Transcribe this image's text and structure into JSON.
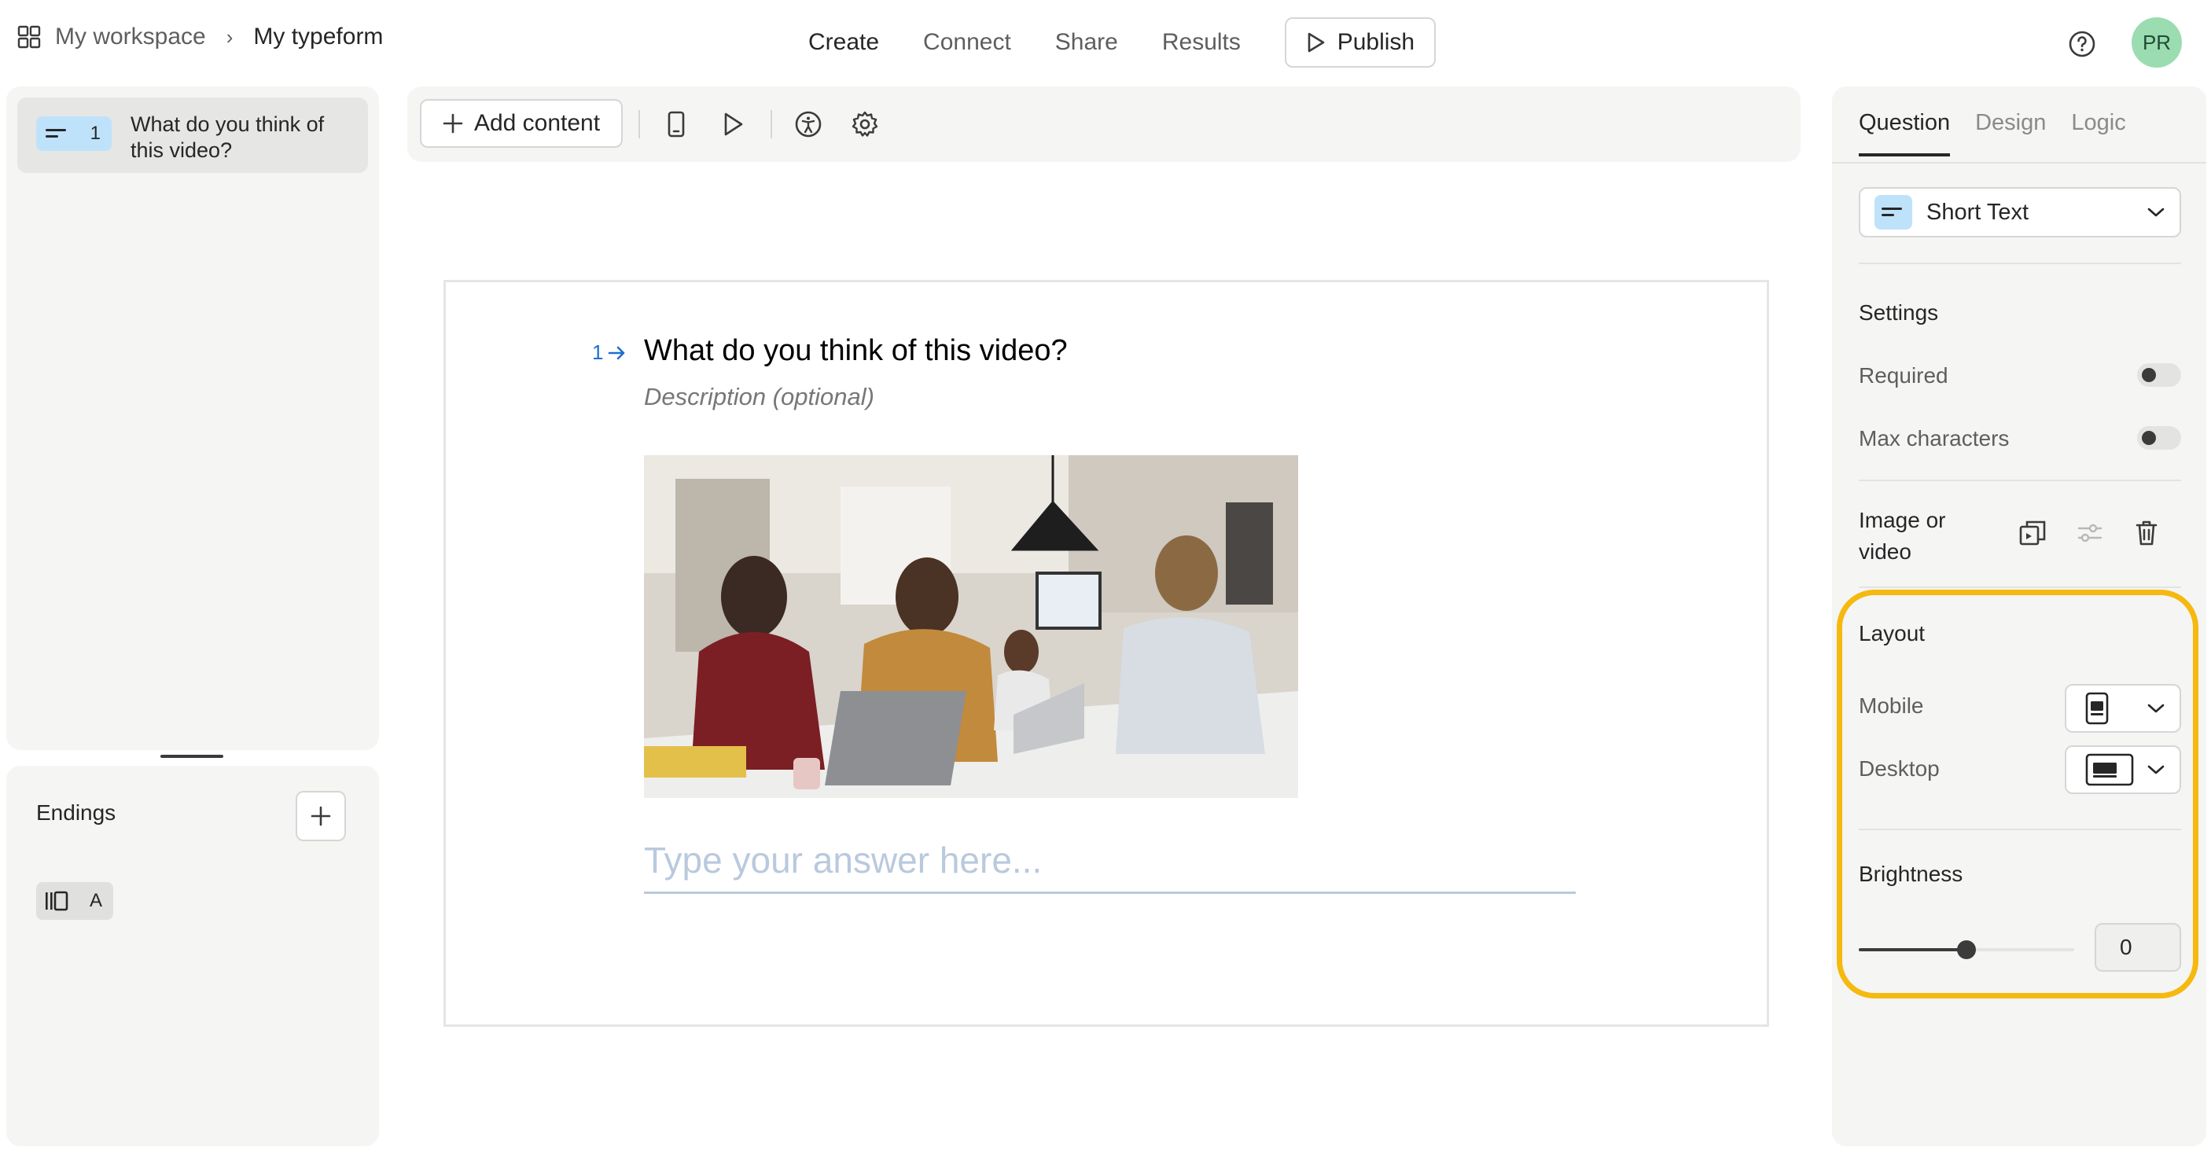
{
  "header": {
    "breadcrumb_workspace": "My workspace",
    "breadcrumb_separator": "›",
    "breadcrumb_form": "My typeform",
    "nav": [
      "Create",
      "Connect",
      "Share",
      "Results"
    ],
    "publish_label": "Publish",
    "avatar_initials": "PR"
  },
  "sidebar": {
    "question": {
      "type_icon": "short-text-icon",
      "number": "1",
      "label": "What do you think of this video?"
    },
    "endings_title": "Endings",
    "ending_badge": {
      "icon": "ending-icon",
      "label": "A"
    }
  },
  "toolbar": {
    "add_content_label": "Add content",
    "icons": [
      "mobile-preview-icon",
      "play-icon",
      "accessibility-icon",
      "settings-icon"
    ]
  },
  "canvas": {
    "question_number": "1",
    "question_title": "What do you think of this video?",
    "description_placeholder": "Description (optional)",
    "answer_placeholder": "Type your answer here..."
  },
  "panel": {
    "tabs": [
      "Question",
      "Design",
      "Logic"
    ],
    "active_tab": "Question",
    "question_type": "Short Text",
    "settings_title": "Settings",
    "required_label": "Required",
    "required_on": false,
    "max_characters_label": "Max characters",
    "max_characters_on": false,
    "image_video_label": "Image or video",
    "layout_title": "Layout",
    "mobile_label": "Mobile",
    "desktop_label": "Desktop",
    "brightness_title": "Brightness",
    "brightness_value": "0",
    "brightness_slider_fraction": 0.5
  },
  "colors": {
    "accent_blue": "#bfe2fb",
    "avatar": "#9bdcb1",
    "highlight": "#f5b90f",
    "question_number": "#1f6fd0"
  }
}
